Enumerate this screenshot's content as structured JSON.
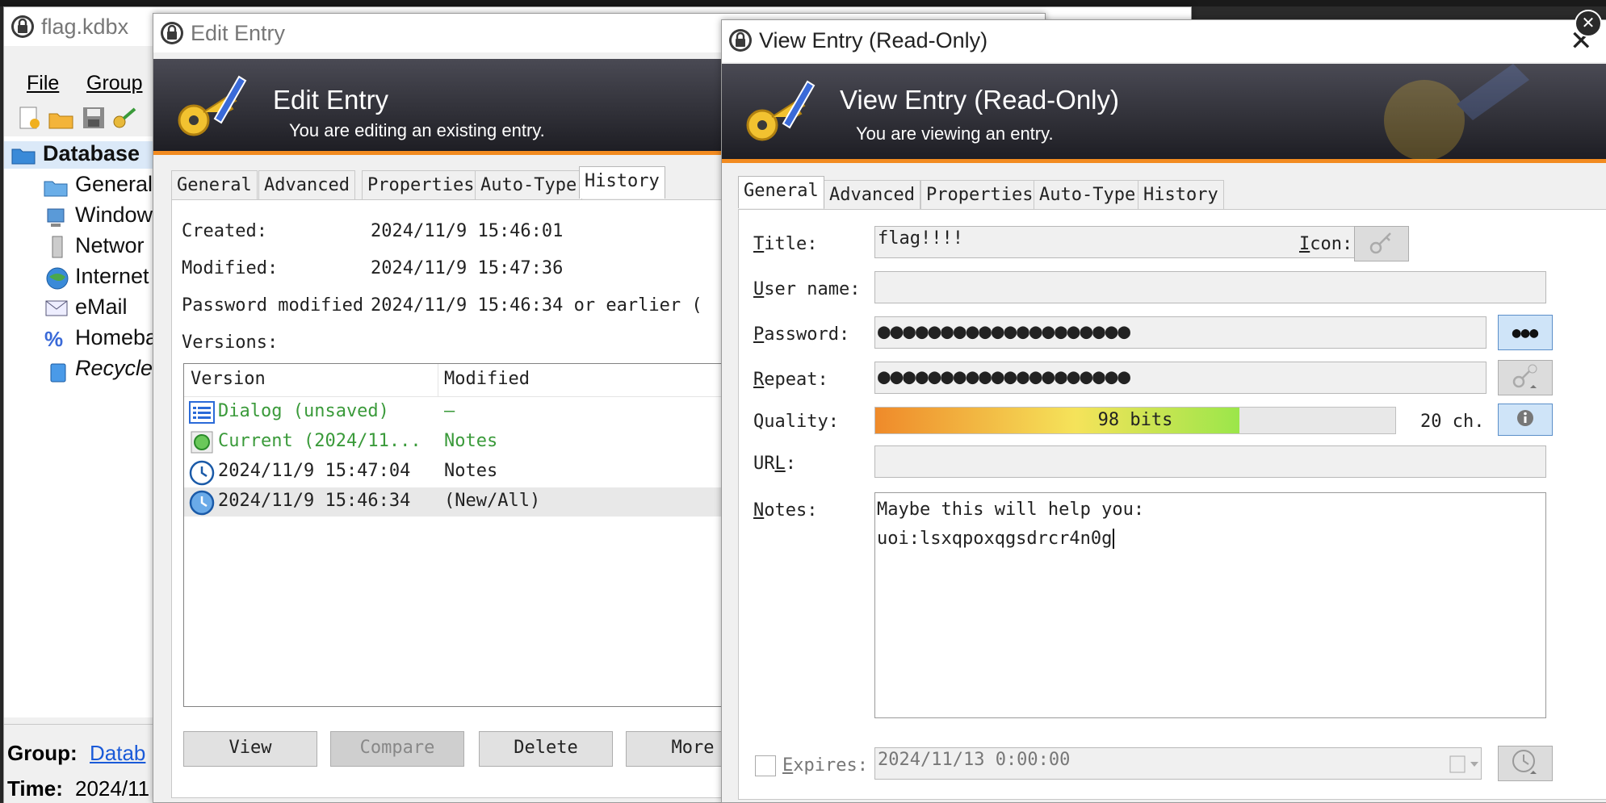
{
  "main_window": {
    "title": "flag.kdbx",
    "menu": [
      "File",
      "Group"
    ],
    "tree": {
      "root": "Database",
      "items": [
        "General",
        "Window",
        "Networ",
        "Internet",
        "eMail",
        "Homeba",
        "Recycle"
      ]
    },
    "status": {
      "group_label": "Group:",
      "group_value": "Datab",
      "time_label": "Time:",
      "time_value": "2024/11"
    }
  },
  "edit_entry": {
    "window_title": "Edit Entry",
    "banner_title": "Edit Entry",
    "banner_subtitle": "You are editing an existing entry.",
    "tabs": [
      "General",
      "Advanced",
      "Properties",
      "Auto-Type",
      "History"
    ],
    "active_tab": "History",
    "created_label": "Created:",
    "created_value": "2024/11/9 15:46:01",
    "modified_label": "Modified:",
    "modified_value": "2024/11/9 15:47:36",
    "pw_modified_label": "Password modified",
    "pw_modified_value": "2024/11/9 15:46:34 or earlier (",
    "versions_label": "Versions:",
    "columns": [
      "Version",
      "Modified"
    ],
    "rows": [
      {
        "version": "Dialog (unsaved)",
        "modified": "—",
        "icon": "dialog-list-icon",
        "green": true
      },
      {
        "version": "Current (2024/11...",
        "modified": "Notes",
        "icon": "current-green-dot-icon",
        "green": true
      },
      {
        "version": "2024/11/9 15:47:04",
        "modified": "Notes",
        "icon": "clock-icon",
        "green": false
      },
      {
        "version": "2024/11/9 15:46:34",
        "modified": "(New/All)",
        "icon": "clock-icon",
        "green": false,
        "selected": true
      }
    ],
    "buttons": {
      "view": "View",
      "compare": "Compare",
      "delete": "Delete",
      "more": "More"
    }
  },
  "view_entry": {
    "window_title": "View Entry (Read-Only)",
    "banner_title": "View Entry (Read-Only)",
    "banner_subtitle": "You are viewing an entry.",
    "tabs": [
      "General",
      "Advanced",
      "Properties",
      "Auto-Type",
      "History"
    ],
    "active_tab": "General",
    "title_label": "Title:",
    "title_value": "flag!!!!",
    "icon_label": "Icon:",
    "username_label": "User name:",
    "username_value": "",
    "password_label": "Password:",
    "password_mask": "●●●●●●●●●●●●●●●●●●●●",
    "repeat_label": "Repeat:",
    "repeat_mask": "●●●●●●●●●●●●●●●●●●●●",
    "show_pw_glyph": "●●●",
    "quality_label": "Quality:",
    "quality_text": "98 bits",
    "quality_fraction": 0.7,
    "quality_chars": "20 ch.",
    "url_label": "URL:",
    "url_value": "",
    "notes_label": "Notes:",
    "notes_line1": "Maybe this will help you:",
    "notes_line2": "uoi:lsxqpoxqgsdrcr4n0g",
    "expires_label": "Expires:",
    "expires_value": "2024/11/13  0:00:00",
    "expires_checked": false
  },
  "colors": {
    "banner_accent": "#f28b20",
    "green_text": "#3a9a3a",
    "quality_start": "#ef8a2a",
    "quality_mid": "#f5e35a",
    "quality_end": "#9be64a"
  }
}
